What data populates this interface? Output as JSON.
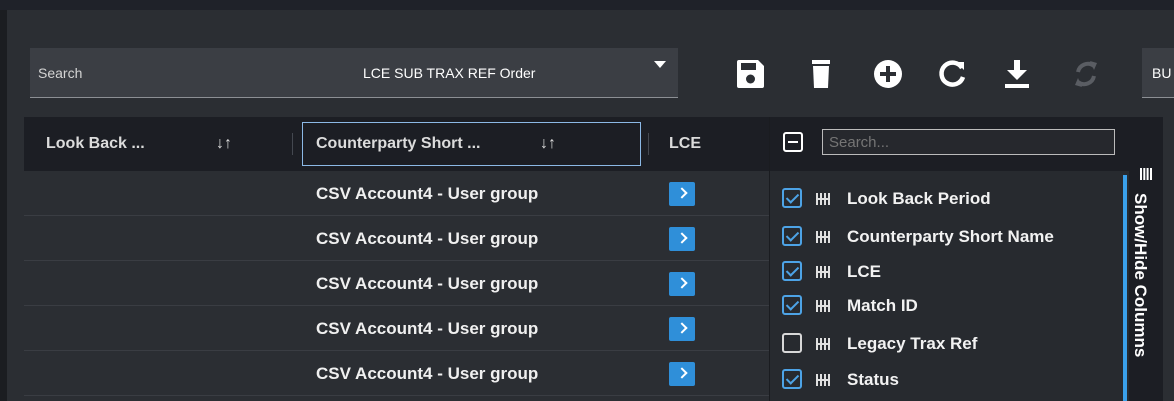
{
  "toolbar": {
    "search_label": "Search",
    "view_name": "LCE SUB TRAX REF Order",
    "cut_off_label": "BU",
    "icons": [
      "save-icon",
      "delete-icon",
      "add-icon",
      "refresh-icon",
      "download-icon",
      "sync-icon"
    ]
  },
  "grid": {
    "columns": [
      {
        "label": "Look Back ...",
        "sort": "↓↑"
      },
      {
        "label": "Counterparty Short ...",
        "sort": "↓↑"
      },
      {
        "label": "LCE"
      }
    ],
    "rows": [
      {
        "counterparty": "CSV Account4 - User group"
      },
      {
        "counterparty": "CSV Account4 - User group"
      },
      {
        "counterparty": "CSV Account4 - User group"
      },
      {
        "counterparty": "CSV Account4 - User group"
      },
      {
        "counterparty": "CSV Account4 - User group"
      }
    ]
  },
  "column_chooser": {
    "search_placeholder": "Search...",
    "items": [
      {
        "label": "Look Back Period",
        "checked": true
      },
      {
        "label": "Counterparty Short Name",
        "checked": true
      },
      {
        "label": "LCE",
        "checked": true
      },
      {
        "label": "Match ID",
        "checked": true
      },
      {
        "label": "Legacy Trax Ref",
        "checked": false
      },
      {
        "label": "Status",
        "checked": true
      }
    ]
  },
  "side_tab": {
    "label": "Show/Hide Columns"
  },
  "colors": {
    "accent": "#2f8fd9",
    "background": "#2b2e33",
    "header": "#1c1e24"
  }
}
